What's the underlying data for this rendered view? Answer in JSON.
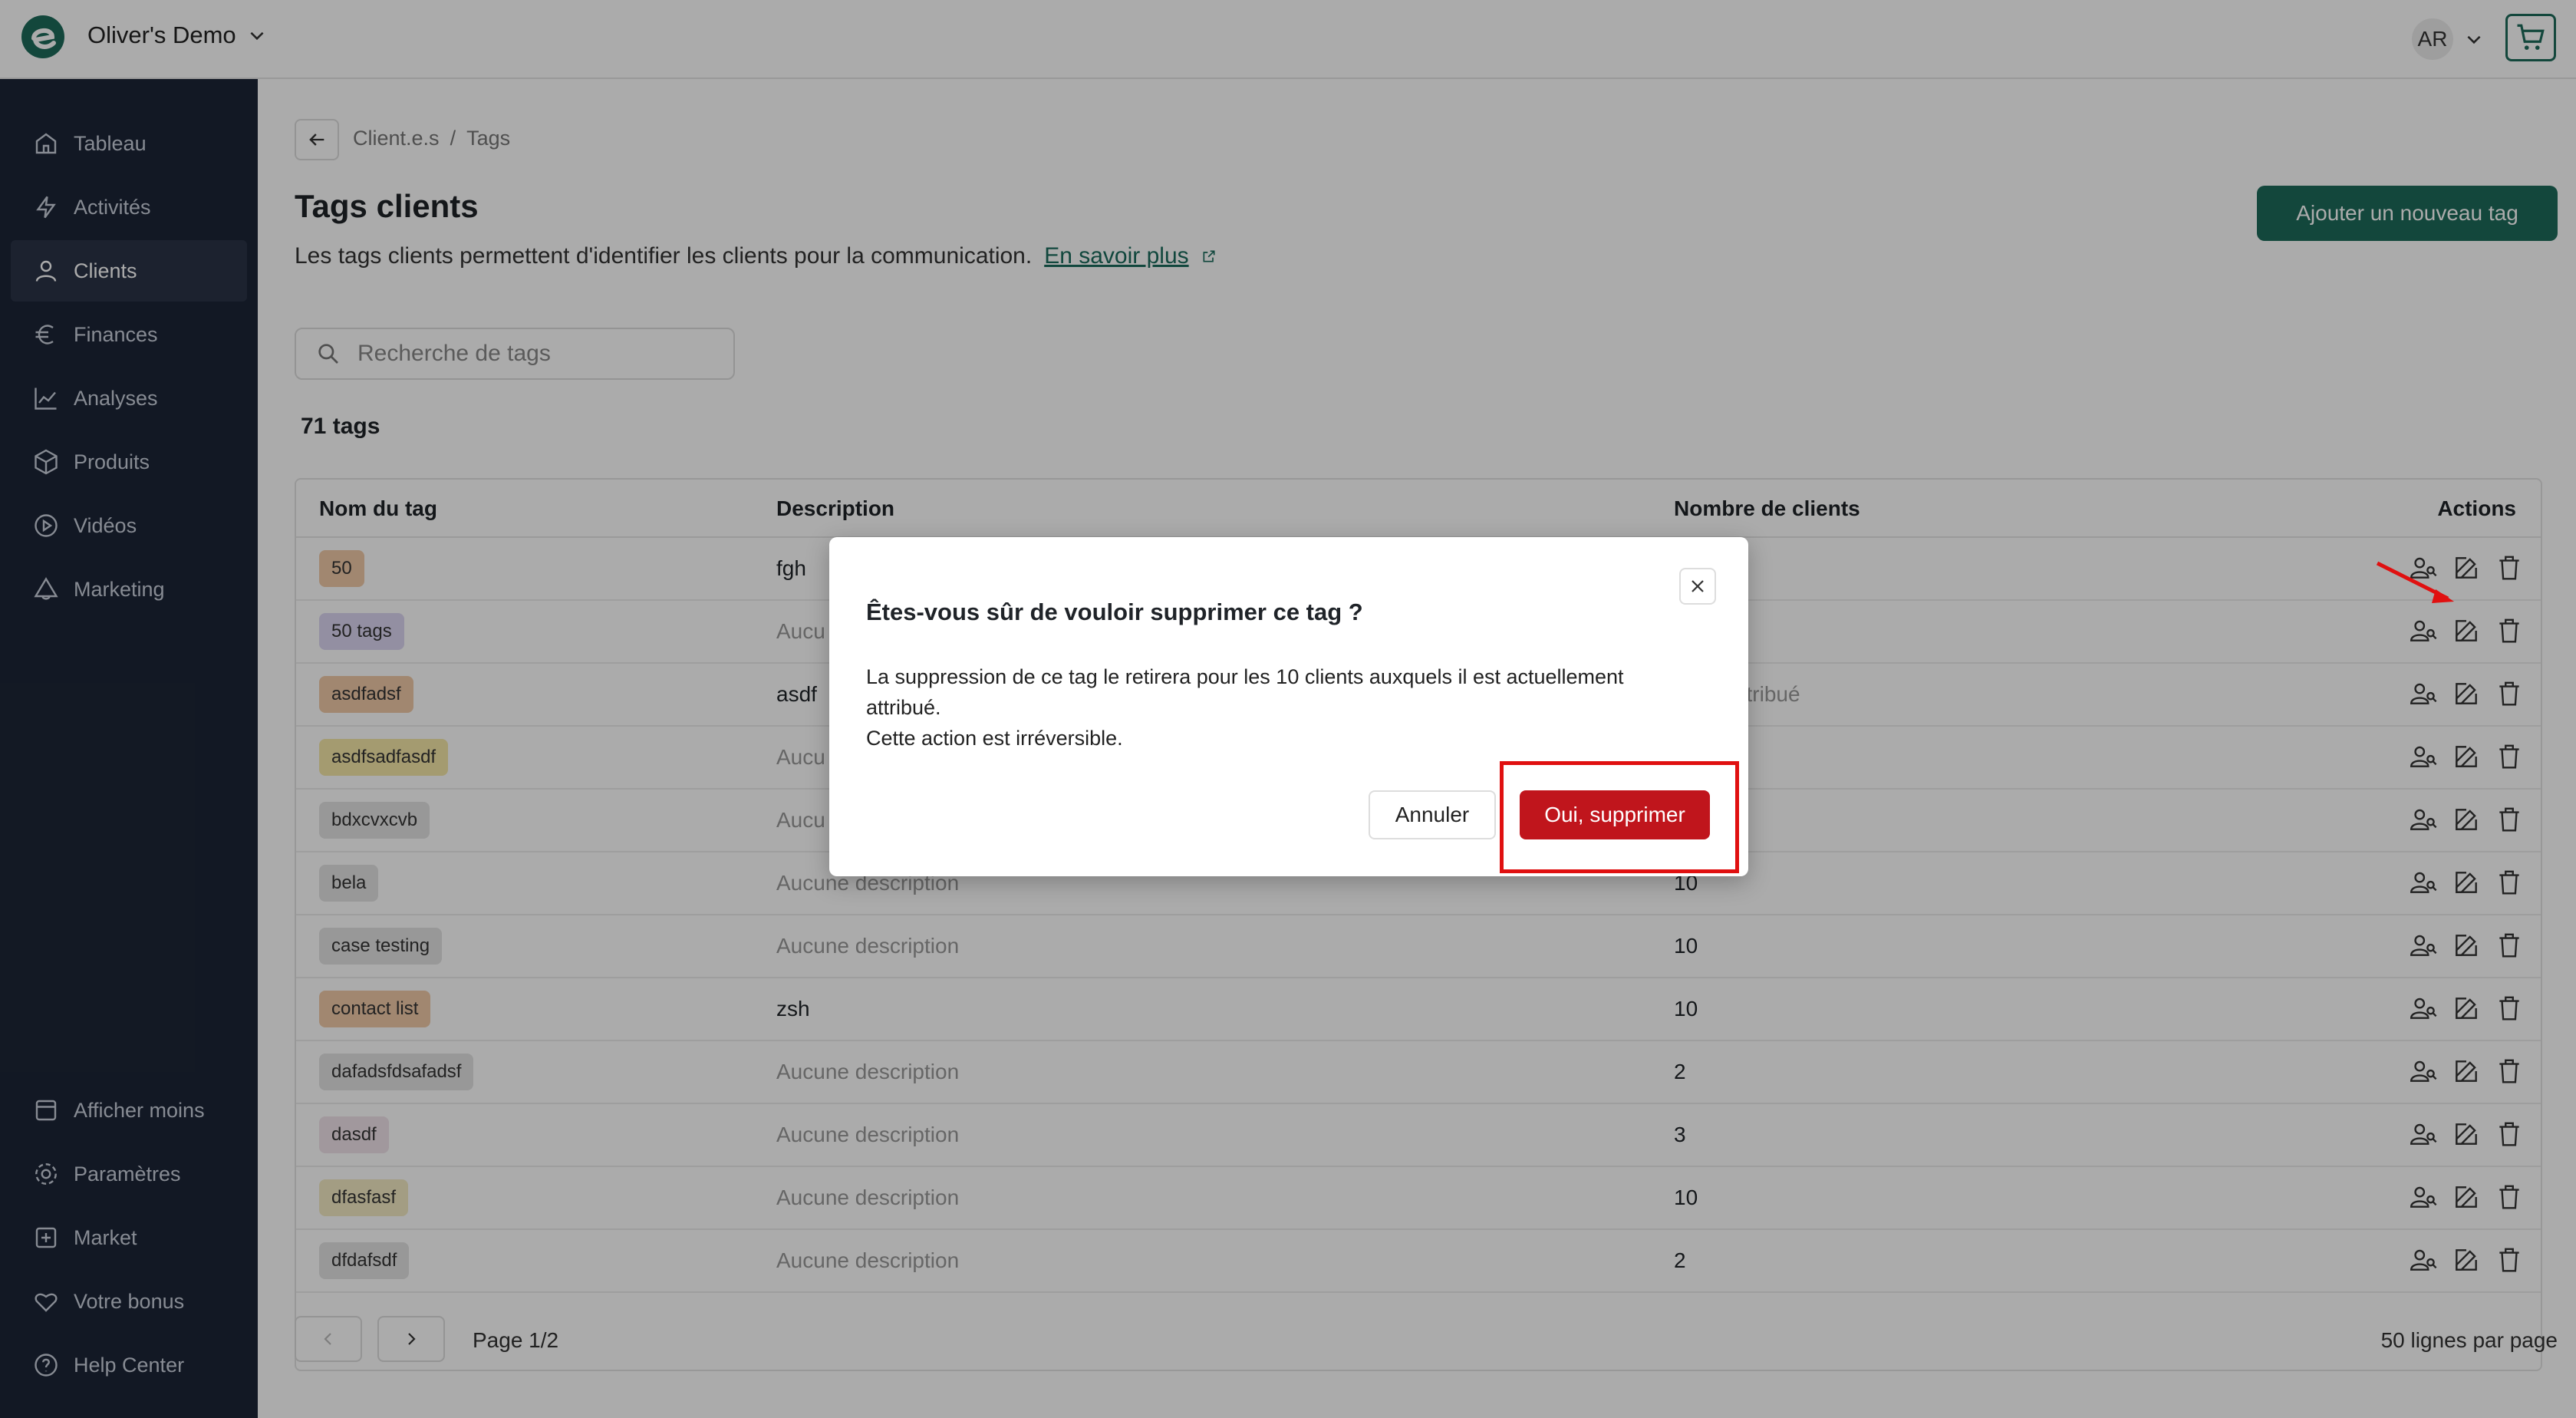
{
  "header": {
    "workspace_name": "Oliver's Demo",
    "user_initials": "AR"
  },
  "sidebar": {
    "items": [
      {
        "label": "Tableau",
        "icon": "home-icon"
      },
      {
        "label": "Activités",
        "icon": "bolt-icon"
      },
      {
        "label": "Clients",
        "icon": "user-icon"
      },
      {
        "label": "Finances",
        "icon": "euro-icon"
      },
      {
        "label": "Analyses",
        "icon": "chart-icon"
      },
      {
        "label": "Produits",
        "icon": "box-icon"
      },
      {
        "label": "Vidéos",
        "icon": "play-icon"
      },
      {
        "label": "Marketing",
        "icon": "megaphone-icon"
      }
    ],
    "bottom_items": [
      {
        "label": "Afficher moins",
        "icon": "panel-icon"
      },
      {
        "label": "Paramètres",
        "icon": "gear-icon"
      },
      {
        "label": "Market",
        "icon": "plus-square-icon"
      },
      {
        "label": "Votre bonus",
        "icon": "heart-icon"
      },
      {
        "label": "Help Center",
        "icon": "help-icon"
      }
    ]
  },
  "breadcrumb": {
    "parent": "Client.e.s",
    "separator": "/",
    "current": "Tags"
  },
  "page": {
    "title": "Tags clients",
    "subtitle": "Les tags clients permettent d'identifier les clients pour la communication.",
    "learn_more": "En savoir plus",
    "add_button": "Ajouter un nouveau tag",
    "search_placeholder": "Recherche de tags",
    "count_label": "71 tags"
  },
  "table": {
    "headers": {
      "name": "Nom du tag",
      "description": "Description",
      "clients": "Nombre de clients",
      "actions": "Actions"
    },
    "rows": [
      {
        "name": "50",
        "color": "#f0c9a8",
        "description": "fgh",
        "muted": false,
        "clients": ""
      },
      {
        "name": "50 tags",
        "color": "#dcd6f2",
        "description": "Aucu",
        "muted": true,
        "clients": ""
      },
      {
        "name": "asdfadsf",
        "color": "#f0c9a8",
        "description": "asdf",
        "muted": false,
        "clients": "lient attribué"
      },
      {
        "name": "asdfsadfasdf",
        "color": "#f5e7a8",
        "description": "Aucu",
        "muted": true,
        "clients": ""
      },
      {
        "name": "bdxcvxcvb",
        "color": "#e3e3e3",
        "description": "Aucu",
        "muted": true,
        "clients": ""
      },
      {
        "name": "bela",
        "color": "#e3e3e3",
        "description": "Aucune description",
        "muted": true,
        "clients": "10"
      },
      {
        "name": "case testing",
        "color": "#e3e3e3",
        "description": "Aucune description",
        "muted": true,
        "clients": "10"
      },
      {
        "name": "contact list",
        "color": "#f0c9a8",
        "description": "zsh",
        "muted": false,
        "clients": "10"
      },
      {
        "name": "dafadsfdsafadsf",
        "color": "#e3e3e3",
        "description": "Aucune description",
        "muted": true,
        "clients": "2"
      },
      {
        "name": "dasdf",
        "color": "#f1e3ea",
        "description": "Aucune description",
        "muted": true,
        "clients": "3"
      },
      {
        "name": "dfasfasf",
        "color": "#f3ebc4",
        "description": "Aucune description",
        "muted": true,
        "clients": "10"
      },
      {
        "name": "dfdafsdf",
        "color": "#e3e3e3",
        "description": "Aucune description",
        "muted": true,
        "clients": "2"
      }
    ]
  },
  "pagination": {
    "page_label": "Page 1/2",
    "rows_per_page": "50 lignes par page"
  },
  "modal": {
    "title": "Êtes-vous sûr de vouloir supprimer ce tag ?",
    "body_line1": "La suppression de ce tag le retirera pour les 10 clients auxquels il est actuellement",
    "body_line2": "attribué.",
    "body_line3": "Cette action est irréversible.",
    "cancel_label": "Annuler",
    "confirm_label": "Oui, supprimer"
  },
  "colors": {
    "brand": "#1d6b5a",
    "sidebar_bg": "#1c2536",
    "danger": "#c0151c",
    "annotation": "#e01010"
  }
}
